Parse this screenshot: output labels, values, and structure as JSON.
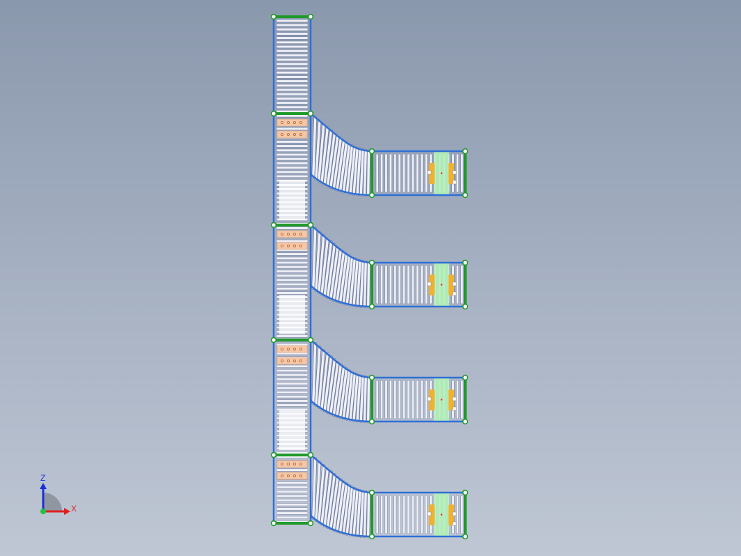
{
  "viewport": {
    "background": [
      "#8a98ad",
      "#bfc7d4"
    ]
  },
  "colors": {
    "frame": "#2f6fd6",
    "joint": "#1f9a2a",
    "node_fill": "#ffffff",
    "roller": "#eef0f6",
    "roller_edge": "#6e7aa0",
    "stop_pad": "#f3c7a8",
    "pallet": "#b4f0b8",
    "actuator": "#f0b030",
    "origin": "#ff3030"
  },
  "triad": {
    "z_label": "Z",
    "x_label": "X",
    "z_color": "#1a2fd8",
    "x_color": "#e02020",
    "y_color": "#20c040"
  },
  "model": {
    "main_line_segments": 5,
    "branch_count": 4
  }
}
